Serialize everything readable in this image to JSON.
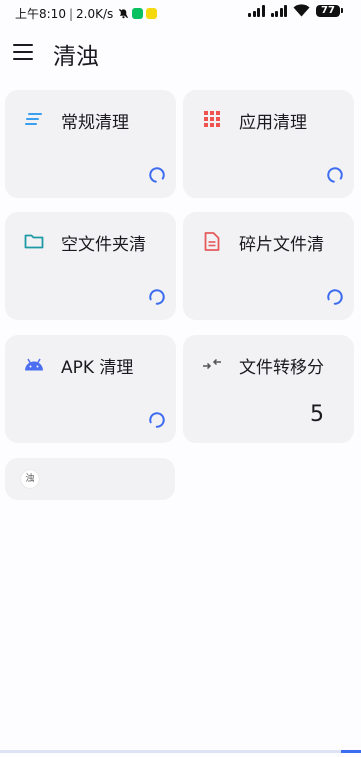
{
  "status_bar": {
    "time": "上午8:10",
    "net_speed": "2.0K/s",
    "battery": "77"
  },
  "header": {
    "title": "清浊"
  },
  "cards": [
    {
      "label": "常规清理",
      "icon": "lines-icon",
      "color": "#3b9ff0",
      "value": ""
    },
    {
      "label": "应用清理",
      "icon": "grid-icon",
      "color": "#ef5350",
      "value": ""
    },
    {
      "label": "空文件夹清",
      "icon": "folder-icon",
      "color": "#1f9aa5",
      "value": ""
    },
    {
      "label": "碎片文件清",
      "icon": "document-icon",
      "color": "#e55b5b",
      "value": ""
    },
    {
      "label": "APK 清理",
      "icon": "android-icon",
      "color": "#4c6ef0",
      "value": ""
    },
    {
      "label": "文件转移分",
      "icon": "transfer-icon",
      "color": "#555555",
      "value": "5"
    }
  ],
  "small_card": {
    "badge": "浊"
  },
  "colors": {
    "spinner": "#3d6cf0",
    "card_bg": "#f2f2f4"
  }
}
